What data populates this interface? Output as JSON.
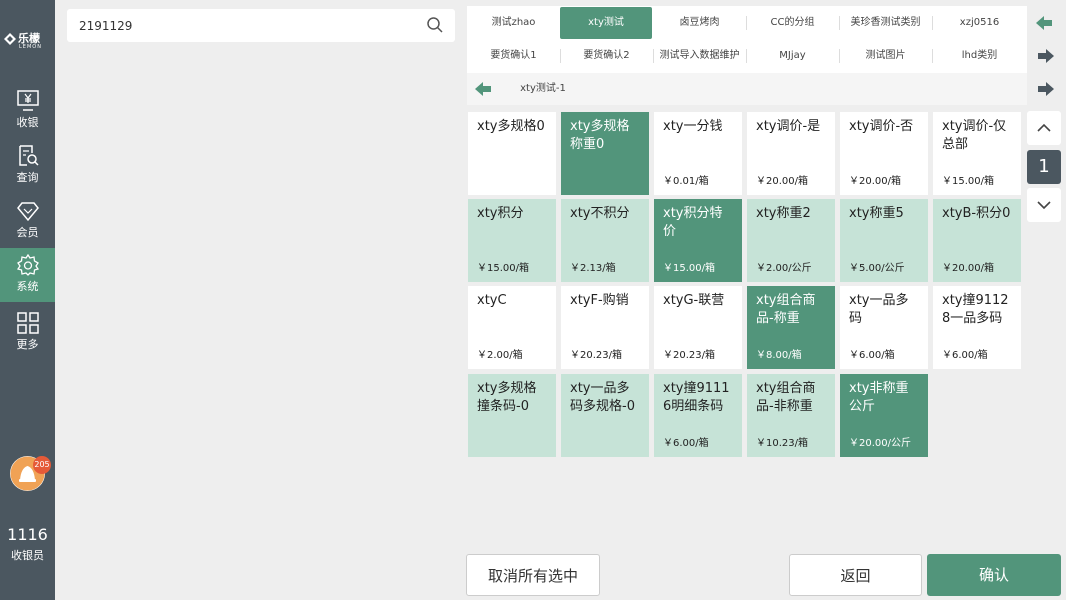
{
  "sidebar": {
    "logo_cn": "乐檬",
    "logo_en": "LEMON",
    "items": [
      {
        "label": "收银",
        "icon": "cashier-icon"
      },
      {
        "label": "查询",
        "icon": "query-icon"
      },
      {
        "label": "会员",
        "icon": "diamond-icon"
      },
      {
        "label": "系统",
        "icon": "gear-icon"
      },
      {
        "label": "更多",
        "icon": "grid-icon"
      }
    ],
    "badge_count": "205",
    "cashier_number": "1116",
    "cashier_label": "收银员"
  },
  "search": {
    "value": "2191129",
    "icon": "search-icon"
  },
  "categories": {
    "row1": [
      "测试zhao",
      "xty测试",
      "卤豆烤肉",
      "CC的分组",
      "美珍香测试类别",
      "xzj0516"
    ],
    "row1_active": "xty测试",
    "row2": [
      "要货确认1",
      "要货确认2",
      "测试导入数据维护",
      "MJjay",
      "测试图片",
      "lhd类别"
    ],
    "subcategory": "xty测试-1"
  },
  "products": [
    {
      "name": "xty多规格0",
      "price": "",
      "style": "white"
    },
    {
      "name": "xty多规格称重0",
      "price": "",
      "style": "dark"
    },
    {
      "name": "xty一分钱",
      "price": "￥0.01/箱",
      "style": "white"
    },
    {
      "name": "xty调价-是",
      "price": "￥20.00/箱",
      "style": "white"
    },
    {
      "name": "xty调价-否",
      "price": "￥20.00/箱",
      "style": "white"
    },
    {
      "name": "xty调价-仅总部",
      "price": "￥15.00/箱",
      "style": "white"
    },
    {
      "name": "xty积分",
      "price": "￥15.00/箱",
      "style": "light"
    },
    {
      "name": "xty不积分",
      "price": "￥2.13/箱",
      "style": "light"
    },
    {
      "name": "xty积分特价",
      "price": "￥15.00/箱",
      "style": "dark"
    },
    {
      "name": "xty称重2",
      "price": "￥2.00/公斤",
      "style": "light"
    },
    {
      "name": "xty称重5",
      "price": "￥5.00/公斤",
      "style": "light"
    },
    {
      "name": "xtyB-积分0",
      "price": "￥20.00/箱",
      "style": "light"
    },
    {
      "name": "xtyC",
      "price": "￥2.00/箱",
      "style": "white"
    },
    {
      "name": "xtyF-购销",
      "price": "￥20.23/箱",
      "style": "white"
    },
    {
      "name": "xtyG-联营",
      "price": "￥20.23/箱",
      "style": "white"
    },
    {
      "name": "xty组合商品-称重",
      "price": "￥8.00/箱",
      "style": "dark"
    },
    {
      "name": "xty一品多码",
      "price": "￥6.00/箱",
      "style": "white"
    },
    {
      "name": "xty撞91128一品多码",
      "price": "￥6.00/箱",
      "style": "white"
    },
    {
      "name": "xty多规格撞条码-0",
      "price": "",
      "style": "light"
    },
    {
      "name": "xty一品多码多规格-0",
      "price": "",
      "style": "light"
    },
    {
      "name": "xty撞91116明细条码",
      "price": "￥6.00/箱",
      "style": "light"
    },
    {
      "name": "xty组合商品-非称重",
      "price": "￥10.23/箱",
      "style": "light"
    },
    {
      "name": "xty非称重公斤",
      "price": "￥20.00/公斤",
      "style": "dark"
    }
  ],
  "pager": {
    "current": "1"
  },
  "buttons": {
    "clear": "取消所有选中",
    "back": "返回",
    "confirm": "确认"
  },
  "colors": {
    "sidebar": "#4b5760",
    "accent": "#52957b",
    "light_accent": "#c6e3d7",
    "badge": "#e55a38"
  }
}
